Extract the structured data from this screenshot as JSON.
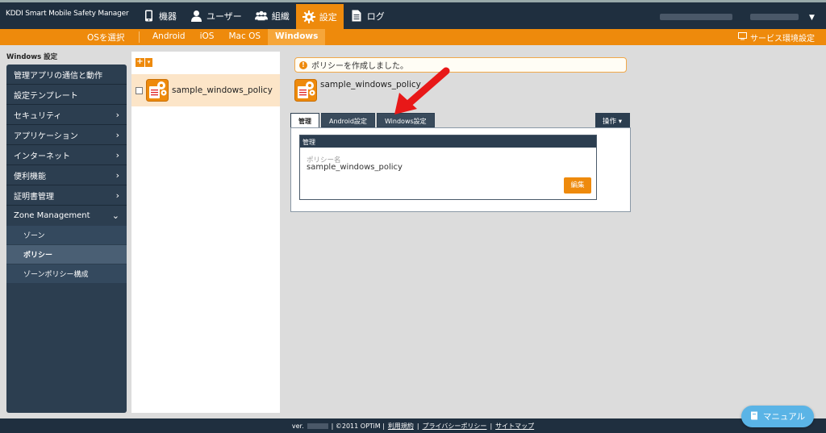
{
  "app": {
    "title": "KDDI Smart Mobile Safety Manager"
  },
  "nav": {
    "items": [
      {
        "label": "機器",
        "icon": "phone-icon"
      },
      {
        "label": "ユーザー",
        "icon": "user-icon"
      },
      {
        "label": "組織",
        "icon": "group-icon"
      },
      {
        "label": "設定",
        "icon": "gear-icon",
        "active": true
      },
      {
        "label": "ログ",
        "icon": "document-icon"
      }
    ]
  },
  "subbar": {
    "os_select_label": "OSを選択",
    "os_tabs": [
      "Android",
      "iOS",
      "Mac OS",
      "Windows"
    ],
    "active_os": "Windows",
    "service_link": "サービス環境設定"
  },
  "sidebar": {
    "title": "Windows 設定",
    "items": [
      {
        "label": "管理アプリの通信と動作"
      },
      {
        "label": "設定テンプレート"
      },
      {
        "label": "セキュリティ",
        "chevron": "›"
      },
      {
        "label": "アプリケーション",
        "chevron": "›"
      },
      {
        "label": "インターネット",
        "chevron": "›"
      },
      {
        "label": "便利機能",
        "chevron": "›"
      },
      {
        "label": "証明書管理",
        "chevron": "›"
      },
      {
        "label": "Zone Management",
        "chevron": "⌄"
      }
    ],
    "subitems": [
      {
        "label": "ゾーン"
      },
      {
        "label": "ポリシー",
        "active": true
      },
      {
        "label": "ゾーンポリシー構成"
      }
    ]
  },
  "policy_list": {
    "add_label": "+",
    "dropdown_label": "▾",
    "rows": [
      {
        "name": "sample_windows_policy"
      }
    ]
  },
  "detail": {
    "notice": "ポリシーを作成しました。",
    "notice_icon": "!",
    "policy_name": "sample_windows_policy",
    "tabs": [
      "管理",
      "Android設定",
      "Windows設定"
    ],
    "ops_button": "操作 ▾",
    "panel_title": "管理",
    "field_label": "ポリシー名",
    "field_value": "sample_windows_policy",
    "edit_button": "編集"
  },
  "footer": {
    "ver_label": "ver.",
    "copyright": "| ©2011 OPTiM |",
    "links": [
      "利用規約",
      "プライバシーポリシー",
      "サイトマップ"
    ],
    "sep": "|"
  },
  "manual_button": "マニュアル",
  "colors": {
    "accent": "#ee8a0c",
    "navy": "#2c3e50",
    "topbar": "#1f2f3f",
    "manual": "#5ab4e6",
    "arrow": "#e81818"
  }
}
